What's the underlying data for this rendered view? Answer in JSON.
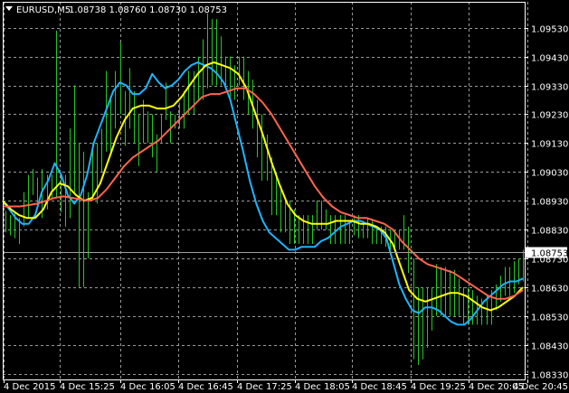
{
  "header": {
    "symbol": "EURUSD,M5",
    "ohlc": "1.08738 1.08760 1.08730 1.08753",
    "menu_icon": "triangle-down-icon"
  },
  "current_price_label": "1.08753",
  "colors": {
    "background": "#000000",
    "grid": "#9a9a9a",
    "bars": "#22c822",
    "ma_fast": "#1eb4ff",
    "ma_mid": "#ffff00",
    "ma_slow": "#ff6450",
    "price_line": "#a0a0a0",
    "axis": "#ffffff"
  },
  "chart_data": {
    "type": "line",
    "instrument": "EURUSD",
    "timeframe": "M5",
    "title": "EURUSD,M5",
    "xlabel": "",
    "ylabel": "",
    "grid": true,
    "legend": "none",
    "ylim": [
      1.0831,
      1.0962
    ],
    "x_ticks": [
      "4 Dec 2015",
      "4 Dec 15:25",
      "4 Dec 16:05",
      "4 Dec 16:45",
      "4 Dec 17:25",
      "4 Dec 18:05",
      "4 Dec 18:45",
      "4 Dec 19:25",
      "4 Dec 20:05",
      "4 Dec 20:45"
    ],
    "y_ticks": [
      1.0953,
      1.0943,
      1.0933,
      1.0923,
      1.0913,
      1.0903,
      1.0893,
      1.0883,
      1.0873,
      1.0863,
      1.0853,
      1.0843,
      1.0833
    ],
    "current_price": 1.08753,
    "bars": [
      {
        "h": 1.08895,
        "l": 1.0882
      },
      {
        "h": 1.0888,
        "l": 1.0881
      },
      {
        "h": 1.0889,
        "l": 1.088
      },
      {
        "h": 1.0887,
        "l": 1.0878
      },
      {
        "h": 1.0896,
        "l": 1.0884
      },
      {
        "h": 1.0902,
        "l": 1.0887
      },
      {
        "h": 1.0904,
        "l": 1.0895
      },
      {
        "h": 1.0901,
        "l": 1.0892
      },
      {
        "h": 1.0904,
        "l": 1.0887
      },
      {
        "h": 1.0902,
        "l": 1.089
      },
      {
        "h": 1.0902,
        "l": 1.0894
      },
      {
        "h": 1.0952,
        "l": 1.0894
      },
      {
        "h": 1.0902,
        "l": 1.0889
      },
      {
        "h": 1.0902,
        "l": 1.0884
      },
      {
        "h": 1.0918,
        "l": 1.0887
      },
      {
        "h": 1.0933,
        "l": 1.0896
      },
      {
        "h": 1.0913,
        "l": 1.0863
      },
      {
        "h": 1.091,
        "l": 1.0863
      },
      {
        "h": 1.0896,
        "l": 1.0873
      },
      {
        "h": 1.0913,
        "l": 1.0893
      },
      {
        "h": 1.0913,
        "l": 1.0892
      },
      {
        "h": 1.0918,
        "l": 1.0903
      },
      {
        "h": 1.0938,
        "l": 1.091
      },
      {
        "h": 1.0928,
        "l": 1.091
      },
      {
        "h": 1.0938,
        "l": 1.0918
      },
      {
        "h": 1.0948,
        "l": 1.0923
      },
      {
        "h": 1.0931,
        "l": 1.0912
      },
      {
        "h": 1.0939,
        "l": 1.0918
      },
      {
        "h": 1.0931,
        "l": 1.0913
      },
      {
        "h": 1.0923,
        "l": 1.0905
      },
      {
        "h": 1.0928,
        "l": 1.0913
      },
      {
        "h": 1.0924,
        "l": 1.0913
      },
      {
        "h": 1.0923,
        "l": 1.0908
      },
      {
        "h": 1.0916,
        "l": 1.0903
      },
      {
        "h": 1.0923,
        "l": 1.0913
      },
      {
        "h": 1.0934,
        "l": 1.0921
      },
      {
        "h": 1.0924,
        "l": 1.0913
      },
      {
        "h": 1.0923,
        "l": 1.0918
      },
      {
        "h": 1.0927,
        "l": 1.0918
      },
      {
        "h": 1.0931,
        "l": 1.0918
      },
      {
        "h": 1.0938,
        "l": 1.0923
      },
      {
        "h": 1.0938,
        "l": 1.0923
      },
      {
        "h": 1.0943,
        "l": 1.0928
      },
      {
        "h": 1.0949,
        "l": 1.0928
      },
      {
        "h": 1.0958,
        "l": 1.0932
      },
      {
        "h": 1.0956,
        "l": 1.0933
      },
      {
        "h": 1.0956,
        "l": 1.0933
      },
      {
        "h": 1.095,
        "l": 1.0933
      },
      {
        "h": 1.0943,
        "l": 1.0933
      },
      {
        "h": 1.0943,
        "l": 1.0928
      },
      {
        "h": 1.094,
        "l": 1.0928
      },
      {
        "h": 1.0943,
        "l": 1.0933
      },
      {
        "h": 1.0943,
        "l": 1.0928
      },
      {
        "h": 1.0938,
        "l": 1.0923
      },
      {
        "h": 1.0935,
        "l": 1.0918
      },
      {
        "h": 1.0928,
        "l": 1.0908
      },
      {
        "h": 1.0923,
        "l": 1.09
      },
      {
        "h": 1.0916,
        "l": 1.09
      },
      {
        "h": 1.0908,
        "l": 1.0888
      },
      {
        "h": 1.0903,
        "l": 1.0888
      },
      {
        "h": 1.0898,
        "l": 1.0882
      },
      {
        "h": 1.0893,
        "l": 1.0882
      },
      {
        "h": 1.0893,
        "l": 1.0878
      },
      {
        "h": 1.089,
        "l": 1.0878
      },
      {
        "h": 1.0888,
        "l": 1.0878
      },
      {
        "h": 1.0888,
        "l": 1.0878
      },
      {
        "h": 1.0888,
        "l": 1.0878
      },
      {
        "h": 1.0888,
        "l": 1.0878
      },
      {
        "h": 1.0893,
        "l": 1.0883
      },
      {
        "h": 1.0893,
        "l": 1.0883
      },
      {
        "h": 1.089,
        "l": 1.0883
      },
      {
        "h": 1.0888,
        "l": 1.0878
      },
      {
        "h": 1.0888,
        "l": 1.0878
      },
      {
        "h": 1.0888,
        "l": 1.0878
      },
      {
        "h": 1.0888,
        "l": 1.0878
      },
      {
        "h": 1.0886,
        "l": 1.0878
      },
      {
        "h": 1.0888,
        "l": 1.0881
      },
      {
        "h": 1.0888,
        "l": 1.088
      },
      {
        "h": 1.0886,
        "l": 1.088
      },
      {
        "h": 1.0887,
        "l": 1.088
      },
      {
        "h": 1.0886,
        "l": 1.0878
      },
      {
        "h": 1.0884,
        "l": 1.0878
      },
      {
        "h": 1.0884,
        "l": 1.0878
      },
      {
        "h": 1.0884,
        "l": 1.0877
      },
      {
        "h": 1.0883,
        "l": 1.0876
      },
      {
        "h": 1.0883,
        "l": 1.0876
      },
      {
        "h": 1.0883,
        "l": 1.0876
      },
      {
        "h": 1.0888,
        "l": 1.0876
      },
      {
        "h": 1.0884,
        "l": 1.0868
      },
      {
        "h": 1.0873,
        "l": 1.0838
      },
      {
        "h": 1.0863,
        "l": 1.0836
      },
      {
        "h": 1.0863,
        "l": 1.0838
      },
      {
        "h": 1.0863,
        "l": 1.0842
      },
      {
        "h": 1.0863,
        "l": 1.0848
      },
      {
        "h": 1.0871,
        "l": 1.0853
      },
      {
        "h": 1.087,
        "l": 1.0853
      },
      {
        "h": 1.087,
        "l": 1.0853
      },
      {
        "h": 1.0869,
        "l": 1.0853
      },
      {
        "h": 1.0869,
        "l": 1.0853
      },
      {
        "h": 1.0866,
        "l": 1.0853
      },
      {
        "h": 1.0863,
        "l": 1.085
      },
      {
        "h": 1.0863,
        "l": 1.085
      },
      {
        "h": 1.0862,
        "l": 1.085
      },
      {
        "h": 1.086,
        "l": 1.085
      },
      {
        "h": 1.0859,
        "l": 1.085
      },
      {
        "h": 1.086,
        "l": 1.085
      },
      {
        "h": 1.0862,
        "l": 1.085
      },
      {
        "h": 1.0864,
        "l": 1.0855
      },
      {
        "h": 1.0867,
        "l": 1.0858
      },
      {
        "h": 1.087,
        "l": 1.086
      },
      {
        "h": 1.087,
        "l": 1.086
      },
      {
        "h": 1.0872,
        "l": 1.0861
      },
      {
        "h": 1.0873,
        "l": 1.0864
      },
      {
        "h": 1.0876,
        "l": 1.0865
      }
    ],
    "series": [
      {
        "color": "#1eb4ff",
        "values": [
          1.0893,
          1.089,
          1.0887,
          1.0885,
          1.0885,
          1.0888,
          1.0896,
          1.09,
          1.0906,
          1.0902,
          1.0895,
          1.0892,
          1.0895,
          1.0902,
          1.0913,
          1.0919,
          1.0925,
          1.0931,
          1.0934,
          1.0933,
          1.093,
          1.093,
          1.0932,
          1.0937,
          1.0934,
          1.0932,
          1.0933,
          1.0935,
          1.0938,
          1.094,
          1.0941,
          1.094,
          1.0939,
          1.0937,
          1.0934,
          1.0928,
          1.0919,
          1.091,
          1.09,
          1.0892,
          1.0886,
          1.0882,
          1.088,
          1.0878,
          1.0876,
          1.0876,
          1.0877,
          1.0877,
          1.0877,
          1.0879,
          1.088,
          1.0882,
          1.0884,
          1.0885,
          1.0886,
          1.0886,
          1.0885,
          1.0884,
          1.0883,
          1.088,
          1.0872,
          1.0864,
          1.0859,
          1.0855,
          1.0854,
          1.0856,
          1.0856,
          1.0855,
          1.0853,
          1.0851,
          1.085,
          1.085,
          1.0852,
          1.0855,
          1.0858,
          1.086,
          1.0862,
          1.0864,
          1.0865,
          1.0865,
          1.0866
        ]
      },
      {
        "color": "#ffff00",
        "values": [
          1.0893,
          1.089,
          1.0888,
          1.0887,
          1.0887,
          1.089,
          1.0896,
          1.0899,
          1.0898,
          1.0895,
          1.0893,
          1.0894,
          1.0899,
          1.0907,
          1.0915,
          1.0921,
          1.0925,
          1.0926,
          1.0926,
          1.0925,
          1.0925,
          1.0926,
          1.0929,
          1.0933,
          1.0937,
          1.094,
          1.0941,
          1.094,
          1.0939,
          1.0937,
          1.0932,
          1.0924,
          1.0916,
          1.0907,
          1.0899,
          1.0892,
          1.0888,
          1.0886,
          1.0885,
          1.0885,
          1.0885,
          1.0886,
          1.0886,
          1.0886,
          1.0885,
          1.0885,
          1.0884,
          1.0882,
          1.0878,
          1.087,
          1.0862,
          1.0859,
          1.0858,
          1.0859,
          1.086,
          1.0861,
          1.0861,
          1.086,
          1.0858,
          1.0856,
          1.0855,
          1.0856,
          1.0858,
          1.086,
          1.0863
        ]
      },
      {
        "color": "#ff6450",
        "values": [
          1.0891,
          1.0891,
          1.0891,
          1.08915,
          1.0892,
          1.0893,
          1.0894,
          1.08945,
          1.0894,
          1.08935,
          1.0893,
          1.0894,
          1.0897,
          1.0901,
          1.0905,
          1.0908,
          1.091,
          1.0912,
          1.0914,
          1.0917,
          1.092,
          1.0923,
          1.0926,
          1.0929,
          1.093,
          1.093,
          1.0931,
          1.0932,
          1.0932,
          1.093,
          1.0927,
          1.0923,
          1.0918,
          1.0913,
          1.0908,
          1.0903,
          1.0898,
          1.0894,
          1.0891,
          1.0889,
          1.0888,
          1.0887,
          1.0887,
          1.0886,
          1.0885,
          1.0883,
          1.0879,
          1.0876,
          1.0873,
          1.0871,
          1.087,
          1.0869,
          1.0868,
          1.0866,
          1.0864,
          1.0862,
          1.086,
          1.0859,
          1.0859,
          1.086,
          1.0862
        ]
      }
    ]
  }
}
